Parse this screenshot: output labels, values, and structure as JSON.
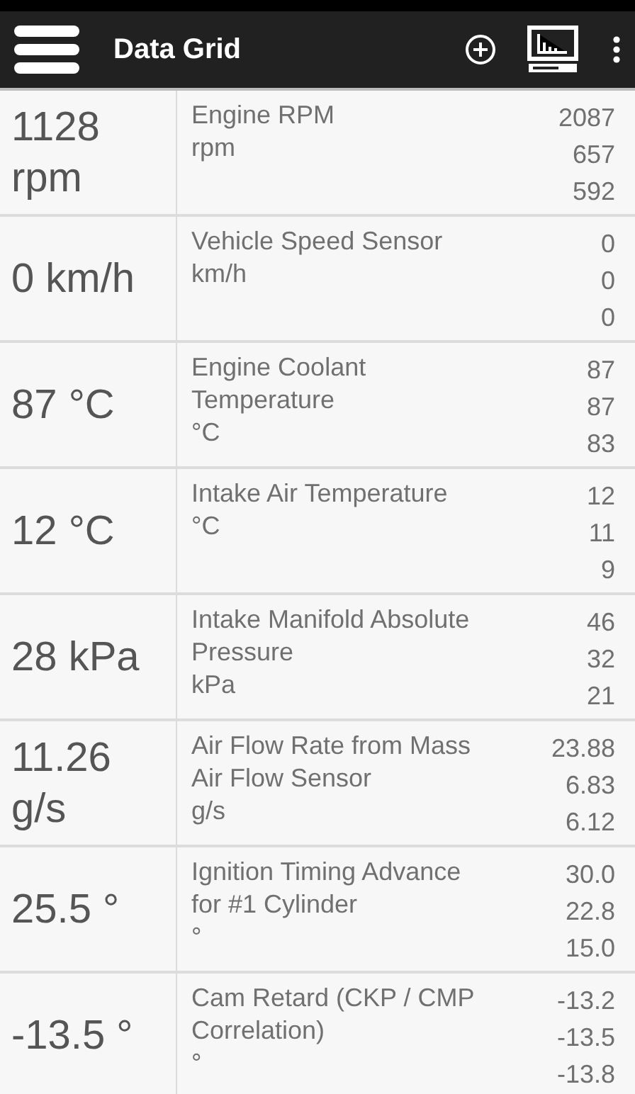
{
  "toolbar": {
    "title": "Data Grid"
  },
  "rows": [
    {
      "value": "1128 rpm",
      "name": "Engine RPM",
      "unit": "rpm",
      "readings": [
        "2087",
        "657",
        "592"
      ]
    },
    {
      "value": "0 km/h",
      "name": "Vehicle Speed Sensor",
      "unit": "km/h",
      "readings": [
        "0",
        "0",
        "0"
      ]
    },
    {
      "value": "87 °C",
      "name": "Engine Coolant Temperature",
      "unit": "°C",
      "readings": [
        "87",
        "87",
        "83"
      ]
    },
    {
      "value": "12 °C",
      "name": "Intake Air Temperature",
      "unit": "°C",
      "readings": [
        "12",
        "11",
        "9"
      ]
    },
    {
      "value": "28 kPa",
      "name": "Intake Manifold Absolute Pressure",
      "unit": "kPa",
      "readings": [
        "46",
        "32",
        "21"
      ]
    },
    {
      "value": "11.26 g/s",
      "name": "Air Flow Rate from Mass Air Flow Sensor",
      "unit": "g/s",
      "readings": [
        "23.88",
        "6.83",
        "6.12"
      ]
    },
    {
      "value": "25.5 °",
      "name": "Ignition Timing Advance for #1 Cylinder",
      "unit": "°",
      "readings": [
        "30.0",
        "22.8",
        "15.0"
      ]
    },
    {
      "value": "-13.5 °",
      "name": "Cam Retard (CKP / CMP Correlation)",
      "unit": "°",
      "readings": [
        "-13.2",
        "-13.5",
        "-13.8"
      ]
    }
  ]
}
